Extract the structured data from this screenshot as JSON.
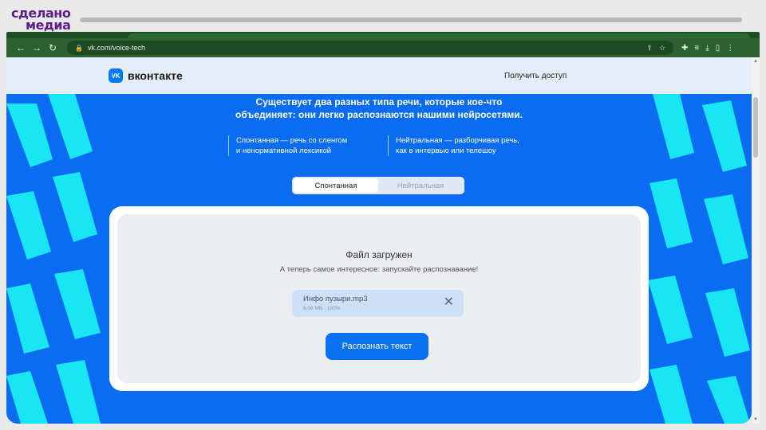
{
  "watermark": {
    "line1": "сделано",
    "line2": "медиа"
  },
  "browser": {
    "url": "vk.com/voice-tech",
    "icons": [
      "back-icon",
      "forward-icon",
      "reload-icon",
      "lock-icon",
      "share-icon",
      "star-icon",
      "extensions-icon",
      "playlist-icon",
      "download-icon",
      "sidepanel-icon",
      "menu-icon"
    ]
  },
  "header": {
    "logo_badge": "VK",
    "brand": "вконтакте",
    "get_access": "Получить доступ"
  },
  "intro": {
    "line1": "Существует два разных типа речи, которые кое-что",
    "line2": "объединяет: они легко распознаются нашими нейросетями."
  },
  "types": [
    {
      "line1": "Спонтанная — речь со сленгом",
      "line2": "и ненормативной лексикой"
    },
    {
      "line1": "Нейтральная — разборчивая речь,",
      "line2": "как в интервью или телешоу"
    }
  ],
  "segmented": {
    "active": "Спонтанная",
    "inactive": "Нейтральная"
  },
  "upload": {
    "title": "Файл загружен",
    "subtitle": "А теперь самое интересное: запускайте распознавание!",
    "file_name": "Инфо пузыри.mp3",
    "file_meta": "6.06 MB · 100%",
    "button": "Распознать текст"
  },
  "colors": {
    "brand_blue": "#0a6cf1",
    "accent_cyan": "#19e6f5",
    "button_blue": "#0a72f0"
  }
}
